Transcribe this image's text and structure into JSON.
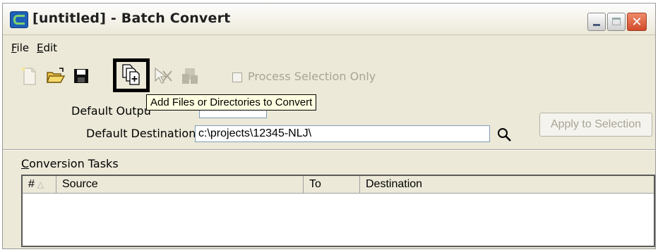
{
  "window": {
    "title": "[untitled] - Batch Convert",
    "close_glyph": "✕"
  },
  "menu": {
    "file": {
      "pre": "",
      "underlined": "F",
      "post": "ile"
    },
    "edit": {
      "pre": "",
      "underlined": "E",
      "post": "dit"
    }
  },
  "toolbar": {
    "icons": [
      "new-file-icon",
      "open-folder-icon",
      "save-icon",
      "add-files-icon",
      "remove-icon",
      "convert-icon"
    ],
    "process_selection_label": "Process Selection Only",
    "process_selection_checked": false
  },
  "tooltip": {
    "text": "Add Files or Directories to Convert"
  },
  "form": {
    "default_output_label": "Default Outpu",
    "default_destination_label": "Default Destination",
    "default_destination_value": "c:\\projects\\12345-NLJ\\",
    "apply_button": "Apply to Selection"
  },
  "tasks": {
    "label_underlined": "C",
    "label_rest": "onversion Tasks",
    "columns": [
      "#",
      "Source",
      "To",
      "Destination"
    ],
    "sort_glyph": "△",
    "rows": []
  },
  "colors": {
    "window_bg": "#ece9d8",
    "tooltip_bg": "#ffffe1",
    "disabled_text": "#a8a595",
    "close_button": "#d04a2a"
  }
}
